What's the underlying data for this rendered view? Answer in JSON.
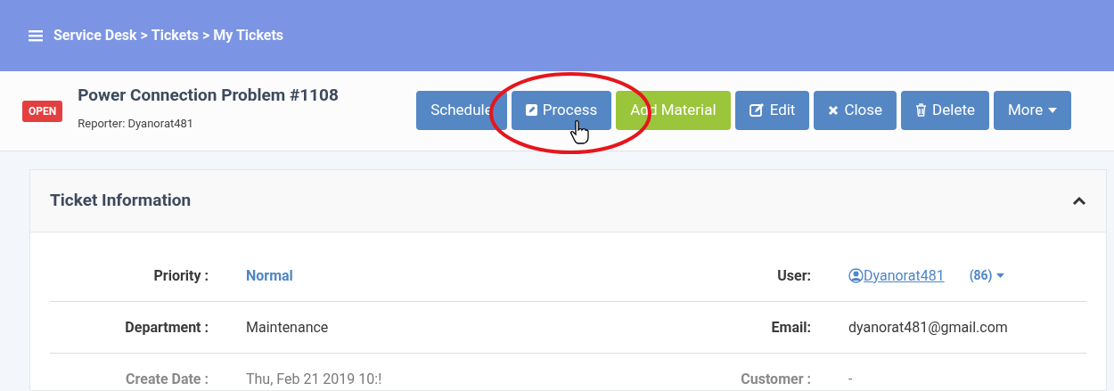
{
  "header": {
    "breadcrumb": [
      "Service Desk",
      "Tickets",
      "My Tickets"
    ],
    "separator": ">"
  },
  "ticket": {
    "status": "OPEN",
    "title": "Power Connection Problem #1108",
    "reporter": "Reporter: Dyanorat481"
  },
  "buttons": [
    {
      "label": "Schedule",
      "kind": "primary"
    },
    {
      "label": "Process",
      "kind": "primary"
    },
    {
      "label": "Add Material",
      "kind": "success"
    },
    {
      "label": "Edit",
      "kind": "primary"
    },
    {
      "label": "Close",
      "kind": "primary"
    },
    {
      "label": "Delete",
      "kind": "primary"
    },
    {
      "label": "More",
      "kind": "primary"
    }
  ],
  "panel": {
    "title": "Ticket Information",
    "expanded": true,
    "rows": [
      {
        "dimmed": false,
        "left": {
          "label": "Priority :",
          "value": "Normal",
          "kind": "link"
        },
        "right": {
          "label": "User:",
          "value": "Dyanorat481",
          "kind": "user",
          "count": "(86)"
        }
      },
      {
        "dimmed": false,
        "left": {
          "label": "Department :",
          "value": "Maintenance",
          "kind": "text"
        },
        "right": {
          "label": "Email:",
          "value": "dyanorat481@gmail.com",
          "kind": "text"
        }
      },
      {
        "dimmed": true,
        "left": {
          "label": "Create Date :",
          "value": "Thu, Feb 21 2019 10:!",
          "kind": "text"
        },
        "right": {
          "label": "Customer :",
          "value": "-",
          "kind": "text"
        }
      }
    ]
  }
}
